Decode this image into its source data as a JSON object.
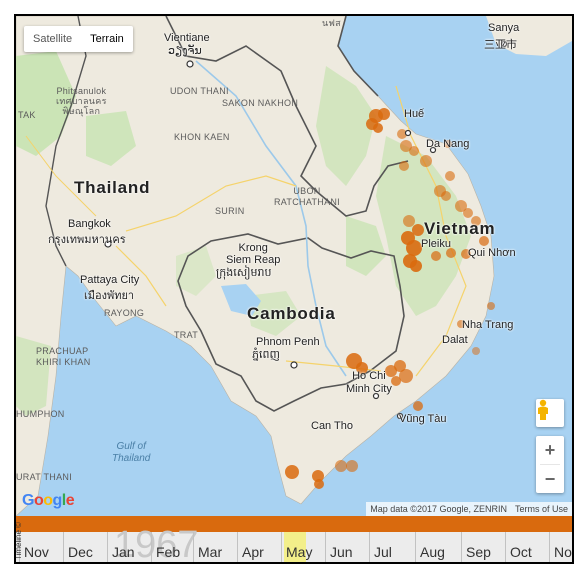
{
  "map": {
    "controls": {
      "satellite_label": "Satellite",
      "terrain_label": "Terrain",
      "zoom_in": "+",
      "zoom_out": "−"
    },
    "countries": {
      "thailand": "Thailand",
      "cambodia": "Cambodia",
      "vietnam": "Vietnam"
    },
    "seas": {
      "gulf_of_thailand": "Gulf of\nThailand"
    },
    "cities": {
      "vientiane": "Vientiane",
      "vientiane_local": "ວຽງຈັນ",
      "bangkok": "Bangkok",
      "bangkok_local": "กรุงเทพมหานคร",
      "pattaya": "Pattaya City",
      "pattaya_local": "เมืองพัทยา",
      "siem_reap": "Krong\nSiem Reap",
      "siem_reap_local": "ក្រុងសៀមរាប",
      "phnom_penh": "Phnom Penh",
      "phnom_penh_local": "ភ្នំពេញ",
      "hue": "Huế",
      "da_nang": "Da Nang",
      "pleiku": "Pleiku",
      "qui_nhon": "Qui Nhơn",
      "nha_trang": "Nha Trang",
      "dalat": "Dalat",
      "ho_chi_minh": "Ho Chi\nMinh City",
      "vung_tau": "Vũng Tàu",
      "can_tho": "Can Tho",
      "sanya": "Sanya",
      "sanya_local": "三亚市"
    },
    "regions": {
      "udon_thani": "UDON THANI",
      "sakon_nakhon": "SAKON NAKHON",
      "khon_kaen": "KHON KAEN",
      "ubon": "UBON\nRATCHATHANI",
      "surin": "SURIN",
      "rayong": "RAYONG",
      "trat": "TRAT",
      "phitsanulok": "Phitsanulok\nเทศบาลนคร\nพิษณุโลก",
      "prachuap": "PRACHUAP\nKHIRI KHAN",
      "chumphon": "HUMPHON",
      "surat": "URAT THANI",
      "tak": "TAK",
      "hanoi_fragment": "นฟส"
    },
    "attribution": {
      "map_data": "Map data ©2017 Google, ZENRIN",
      "terms": "Terms of Use"
    },
    "logo": "Google",
    "colors": {
      "water": "#a8d2f2",
      "land": "#eeeadf",
      "forest": "#c7e3b1",
      "marker": "#d96a0e",
      "border": "#555555"
    }
  },
  "timeline": {
    "label": "Timeline ©",
    "year": "1967",
    "months": [
      "Nov",
      "Dec",
      "Jan",
      "Feb",
      "Mar",
      "Apr",
      "May",
      "Jun",
      "Jul",
      "Aug",
      "Sep",
      "Oct",
      "No"
    ],
    "highlighted_month": "May",
    "colors": {
      "bar": "#d96a0e",
      "highlight": "#f3ef8a"
    }
  }
}
